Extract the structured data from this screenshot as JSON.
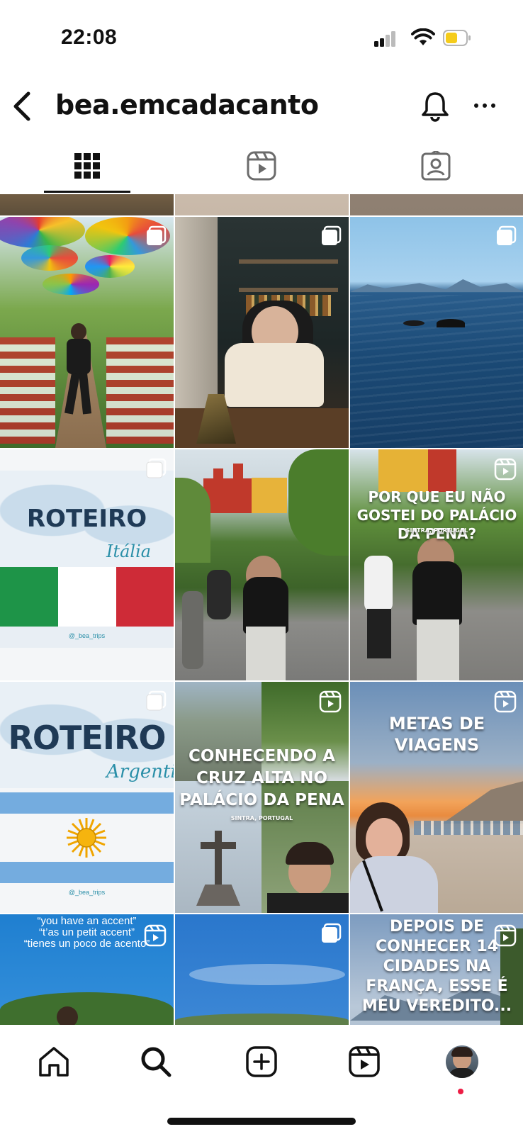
{
  "status_bar": {
    "time": "22:08"
  },
  "header": {
    "username": "bea.emcadacanto"
  },
  "tabs": [
    {
      "name": "posts",
      "active": true
    },
    {
      "name": "reels",
      "active": false
    },
    {
      "name": "tagged",
      "active": false
    }
  ],
  "posts": {
    "italia": {
      "title": "ROTEIRO",
      "script": "Itália",
      "handle": "@_bea_trips"
    },
    "pena_reel": {
      "title": "POR QUE EU NÃO GOSTEI DO PALÁCIO DA PENA?",
      "sub": "SINTRA, PORTUGAL"
    },
    "argentina": {
      "title": "ROTEIRO",
      "script": "Argentina",
      "handle": "@_bea_trips"
    },
    "cruz_reel": {
      "title": "CONHECENDO A CRUZ ALTA NO PALÁCIO DA PENA",
      "sub": "SINTRA, PORTUGAL"
    },
    "metas_reel": {
      "title": "METAS DE VIAGENS"
    },
    "accent_reel": {
      "line1": "“you have an accent”",
      "line2": "“t’as un petit accent”",
      "line3": "“tienes un poco de acento”"
    },
    "franca_reel": {
      "title": "DEPOIS DE CONHECER 14 CIDADES NA FRANÇA, ESSE É MEU VEREDITO..."
    }
  },
  "icons": {
    "grid": "grid-icon",
    "reels": "reels-icon",
    "tagged": "tagged-icon",
    "home": "home-icon",
    "search": "search-icon",
    "create": "create-icon",
    "reels_nav": "reels-nav-icon",
    "profile": "profile-avatar"
  },
  "colors": {
    "notification_dot": "#ed1c44",
    "battery": "#f5cc1b"
  }
}
